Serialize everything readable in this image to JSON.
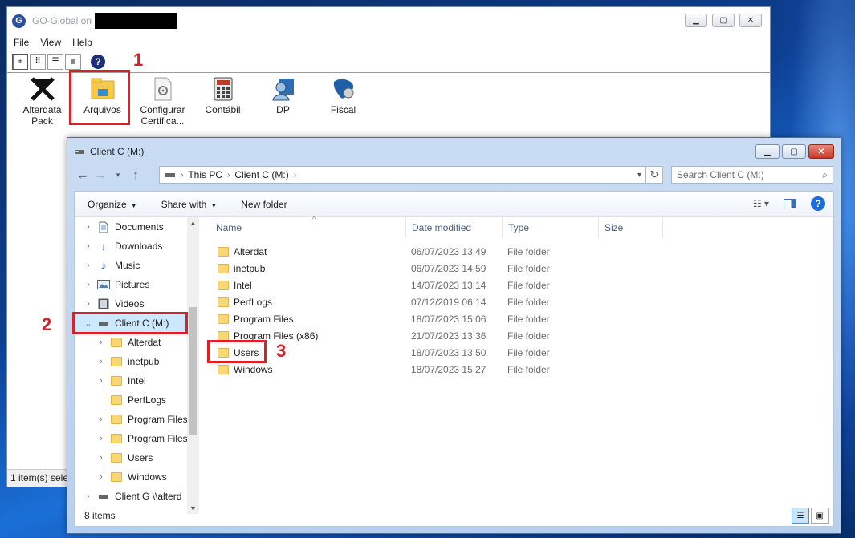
{
  "gg": {
    "title": "GO-Global on",
    "menu": [
      "File",
      "View",
      "Help"
    ],
    "toolbar_icons": [
      "large-icons-view",
      "small-icons-view",
      "list-view",
      "details-view",
      "help"
    ],
    "apps": [
      {
        "label": "Alterdata Pack",
        "icon": "alterdata-logo-icon"
      },
      {
        "label": "Arquivos",
        "icon": "file-explorer-icon"
      },
      {
        "label": "Configurar Certifica...",
        "icon": "certificate-config-icon"
      },
      {
        "label": "Contábil",
        "icon": "calculator-icon"
      },
      {
        "label": "DP",
        "icon": "dp-person-icon"
      },
      {
        "label": "Fiscal",
        "icon": "fiscal-map-icon"
      }
    ],
    "status": "1 item(s) sele"
  },
  "annotations": {
    "one": "1",
    "two": "2",
    "three": "3"
  },
  "explorer": {
    "title": "Client C (M:)",
    "address": [
      "This PC",
      "Client C (M:)"
    ],
    "search_placeholder": "Search Client C (M:)",
    "commands": [
      "Organize",
      "Share with",
      "New folder"
    ],
    "tree": [
      {
        "label": "Documents",
        "icon": "documents-icon",
        "indent": 0,
        "expand": true
      },
      {
        "label": "Downloads",
        "icon": "downloads-icon",
        "indent": 0,
        "expand": true
      },
      {
        "label": "Music",
        "icon": "music-icon",
        "indent": 0,
        "expand": true
      },
      {
        "label": "Pictures",
        "icon": "pictures-icon",
        "indent": 0,
        "expand": true
      },
      {
        "label": "Videos",
        "icon": "videos-icon",
        "indent": 0,
        "expand": true
      },
      {
        "label": "Client C (M:)",
        "icon": "drive-icon",
        "indent": 0,
        "expand": "open",
        "selected": true
      },
      {
        "label": "Alterdat",
        "icon": "folder-icon",
        "indent": 1,
        "expand": true
      },
      {
        "label": "inetpub",
        "icon": "folder-icon",
        "indent": 1,
        "expand": true
      },
      {
        "label": "Intel",
        "icon": "folder-icon",
        "indent": 1,
        "expand": true
      },
      {
        "label": "PerfLogs",
        "icon": "folder-icon",
        "indent": 1,
        "expand": false
      },
      {
        "label": "Program Files",
        "icon": "folder-icon",
        "indent": 1,
        "expand": true
      },
      {
        "label": "Program Files (",
        "icon": "folder-icon",
        "indent": 1,
        "expand": true
      },
      {
        "label": "Users",
        "icon": "folder-icon",
        "indent": 1,
        "expand": true
      },
      {
        "label": "Windows",
        "icon": "folder-icon",
        "indent": 1,
        "expand": true
      },
      {
        "label": "Client G \\\\alterd",
        "icon": "drive-icon",
        "indent": 0,
        "expand": true
      }
    ],
    "columns": [
      "Name",
      "Date modified",
      "Type",
      "Size"
    ],
    "files": [
      {
        "name": "Alterdat",
        "date": "06/07/2023 13:49",
        "type": "File folder"
      },
      {
        "name": "inetpub",
        "date": "06/07/2023 14:59",
        "type": "File folder"
      },
      {
        "name": "Intel",
        "date": "14/07/2023 13:14",
        "type": "File folder"
      },
      {
        "name": "PerfLogs",
        "date": "07/12/2019 06:14",
        "type": "File folder"
      },
      {
        "name": "Program Files",
        "date": "18/07/2023 15:06",
        "type": "File folder"
      },
      {
        "name": "Program Files (x86)",
        "date": "21/07/2023 13:36",
        "type": "File folder"
      },
      {
        "name": "Users",
        "date": "18/07/2023 13:50",
        "type": "File folder"
      },
      {
        "name": "Windows",
        "date": "18/07/2023 15:27",
        "type": "File folder"
      }
    ],
    "status": "8 items"
  },
  "colors": {
    "annotation_red": "#e01e25",
    "selection": "#cce8ff",
    "folder": "#f8d775"
  }
}
